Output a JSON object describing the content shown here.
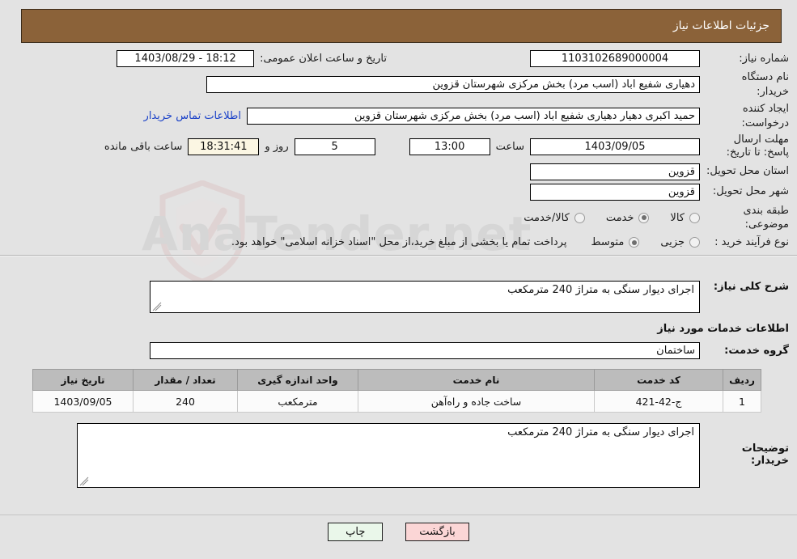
{
  "header": {
    "title": "جزئیات اطلاعات نیاز"
  },
  "form": {
    "need_number_label": "شماره نیاز:",
    "need_number_value": "1103102689000004",
    "announce_datetime_label": "تاریخ و ساعت اعلان عمومی:",
    "announce_datetime_value": "18:12 - 1403/08/29",
    "buyer_org_label": "نام دستگاه خریدار:",
    "buyer_org_value": "دهیاری شفیع اباد (اسب مرد) بخش مرکزی شهرستان قزوین",
    "creator_label": "ایجاد کننده درخواست:",
    "creator_value": "حمید اکبری دهیار دهیاری شفیع اباد (اسب مرد) بخش مرکزی شهرستان قزوین",
    "contact_link": "اطلاعات تماس خریدار",
    "deadline_label": "مهلت ارسال پاسخ: تا تاریخ:",
    "deadline_date": "1403/09/05",
    "hour_label": "ساعت",
    "hour_value": "13:00",
    "days_value": "5",
    "days_word": "روز و",
    "timer_value": "18:31:41",
    "remaining_label": "ساعت باقی مانده",
    "province_label": "استان محل تحویل:",
    "province_value": "قزوین",
    "city_label": "شهر محل تحویل:",
    "city_value": "قزوین",
    "category_label": "طبقه بندی موضوعی:",
    "category_options": [
      {
        "label": "کالا",
        "selected": false
      },
      {
        "label": "خدمت",
        "selected": true
      },
      {
        "label": "کالا/خدمت",
        "selected": false
      }
    ],
    "process_label": "نوع فرآیند خرید :",
    "process_options": [
      {
        "label": "جزیی",
        "selected": false
      },
      {
        "label": "متوسط",
        "selected": true
      }
    ],
    "treasury_note": "پرداخت تمام یا بخشی از مبلغ خرید،از محل \"اسناد خزانه اسلامی\" خواهد بود."
  },
  "details": {
    "general_desc_label": "شرح کلی نیاز:",
    "general_desc_value": "اجرای دیوار سنگی به متراژ 240 مترمکعب",
    "services_section_title": "اطلاعات خدمات مورد نیاز",
    "service_group_label": "گروه خدمت:",
    "service_group_value": "ساختمان",
    "buyer_notes_label": "توضیحات خریدار:",
    "buyer_notes_value": "اجرای دیوار سنگی به متراژ 240 مترمکعب"
  },
  "table": {
    "columns": [
      "ردیف",
      "کد خدمت",
      "نام خدمت",
      "واحد اندازه گیری",
      "تعداد / مقدار",
      "تاریخ نیاز"
    ],
    "rows": [
      {
        "radif": "1",
        "code": "ج-42-421",
        "name": "ساخت جاده و راه‌آهن",
        "unit": "مترمکعب",
        "qty": "240",
        "date": "1403/09/05"
      }
    ]
  },
  "footer": {
    "print_label": "چاپ",
    "back_label": "بازگشت"
  },
  "watermark": {
    "text": "AnaTender.net"
  },
  "colors": {
    "header_bar": "#8b6239",
    "link": "#1b42c8",
    "table_header": "#bcbcbc",
    "print_button": "#eaf7ea",
    "back_button": "#fbd6d6",
    "timer_field": "#fbf6e3"
  }
}
